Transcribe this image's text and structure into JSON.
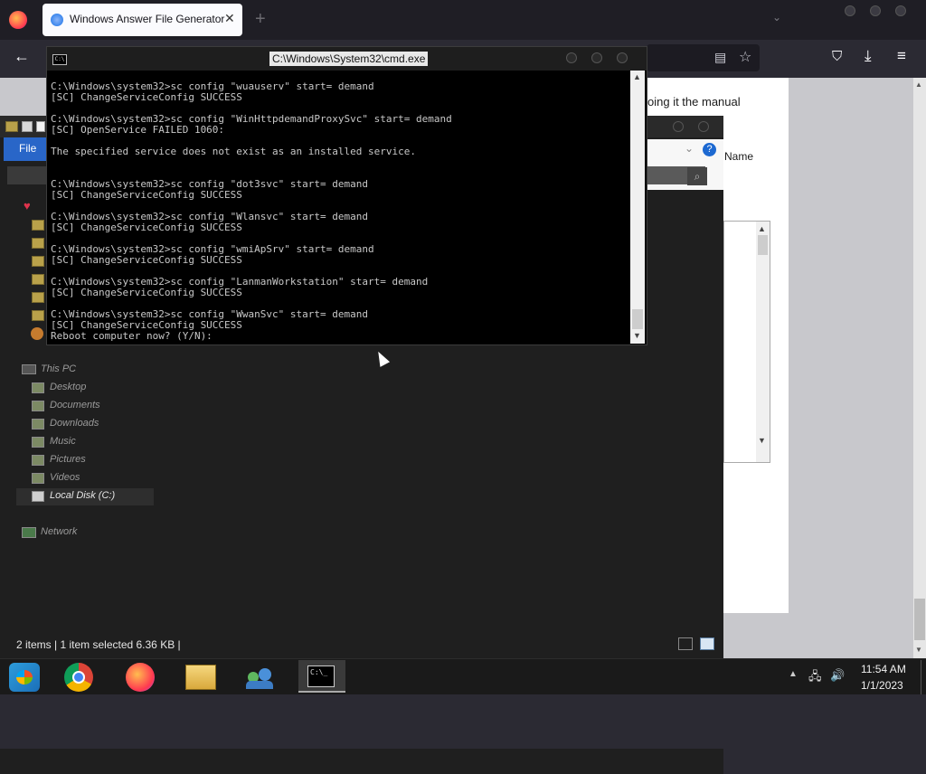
{
  "browser": {
    "tab_title": "Windows Answer File Generator",
    "tab_close": "✕",
    "new_tab": "+",
    "tab_list": "⌄",
    "back": "←",
    "reader": "▤",
    "bookmark": "☆",
    "pocket": "⛉",
    "downloads": "⤓",
    "menu": "≡"
  },
  "webpage": {
    "visible_text": "oing it the manual"
  },
  "explorer": {
    "file_tab": "File",
    "help": "?",
    "column_name": "Name",
    "nav_tree": {
      "this_pc": "This PC",
      "desktop": "Desktop",
      "documents": "Documents",
      "downloads": "Downloads",
      "music": "Music",
      "pictures": "Pictures",
      "videos": "Videos",
      "local_disk": "Local Disk (C:)",
      "network": "Network"
    },
    "status": "2 items  |  1 item selected  6.36 KB  |"
  },
  "cmd": {
    "title": "C:\\Windows\\System32\\cmd.exe",
    "output": "C:\\Windows\\system32>sc config \"wuauserv\" start= demand\n[SC] ChangeServiceConfig SUCCESS\n\nC:\\Windows\\system32>sc config \"WinHttpdemandProxySvc\" start= demand\n[SC] OpenService FAILED 1060:\n\nThe specified service does not exist as an installed service.\n\n\nC:\\Windows\\system32>sc config \"dot3svc\" start= demand\n[SC] ChangeServiceConfig SUCCESS\n\nC:\\Windows\\system32>sc config \"Wlansvc\" start= demand\n[SC] ChangeServiceConfig SUCCESS\n\nC:\\Windows\\system32>sc config \"wmiApSrv\" start= demand\n[SC] ChangeServiceConfig SUCCESS\n\nC:\\Windows\\system32>sc config \"LanmanWorkstation\" start= demand\n[SC] ChangeServiceConfig SUCCESS\n\nC:\\Windows\\system32>sc config \"WwanSvc\" start= demand\n[SC] ChangeServiceConfig SUCCESS\nReboot computer now? (Y/N):"
  },
  "taskbar": {
    "cmd_label": "C:\\_",
    "tray_chevron": "▲",
    "network": "🖧",
    "volume": "🔊",
    "time": "11:54 AM",
    "date": "1/1/2023"
  }
}
